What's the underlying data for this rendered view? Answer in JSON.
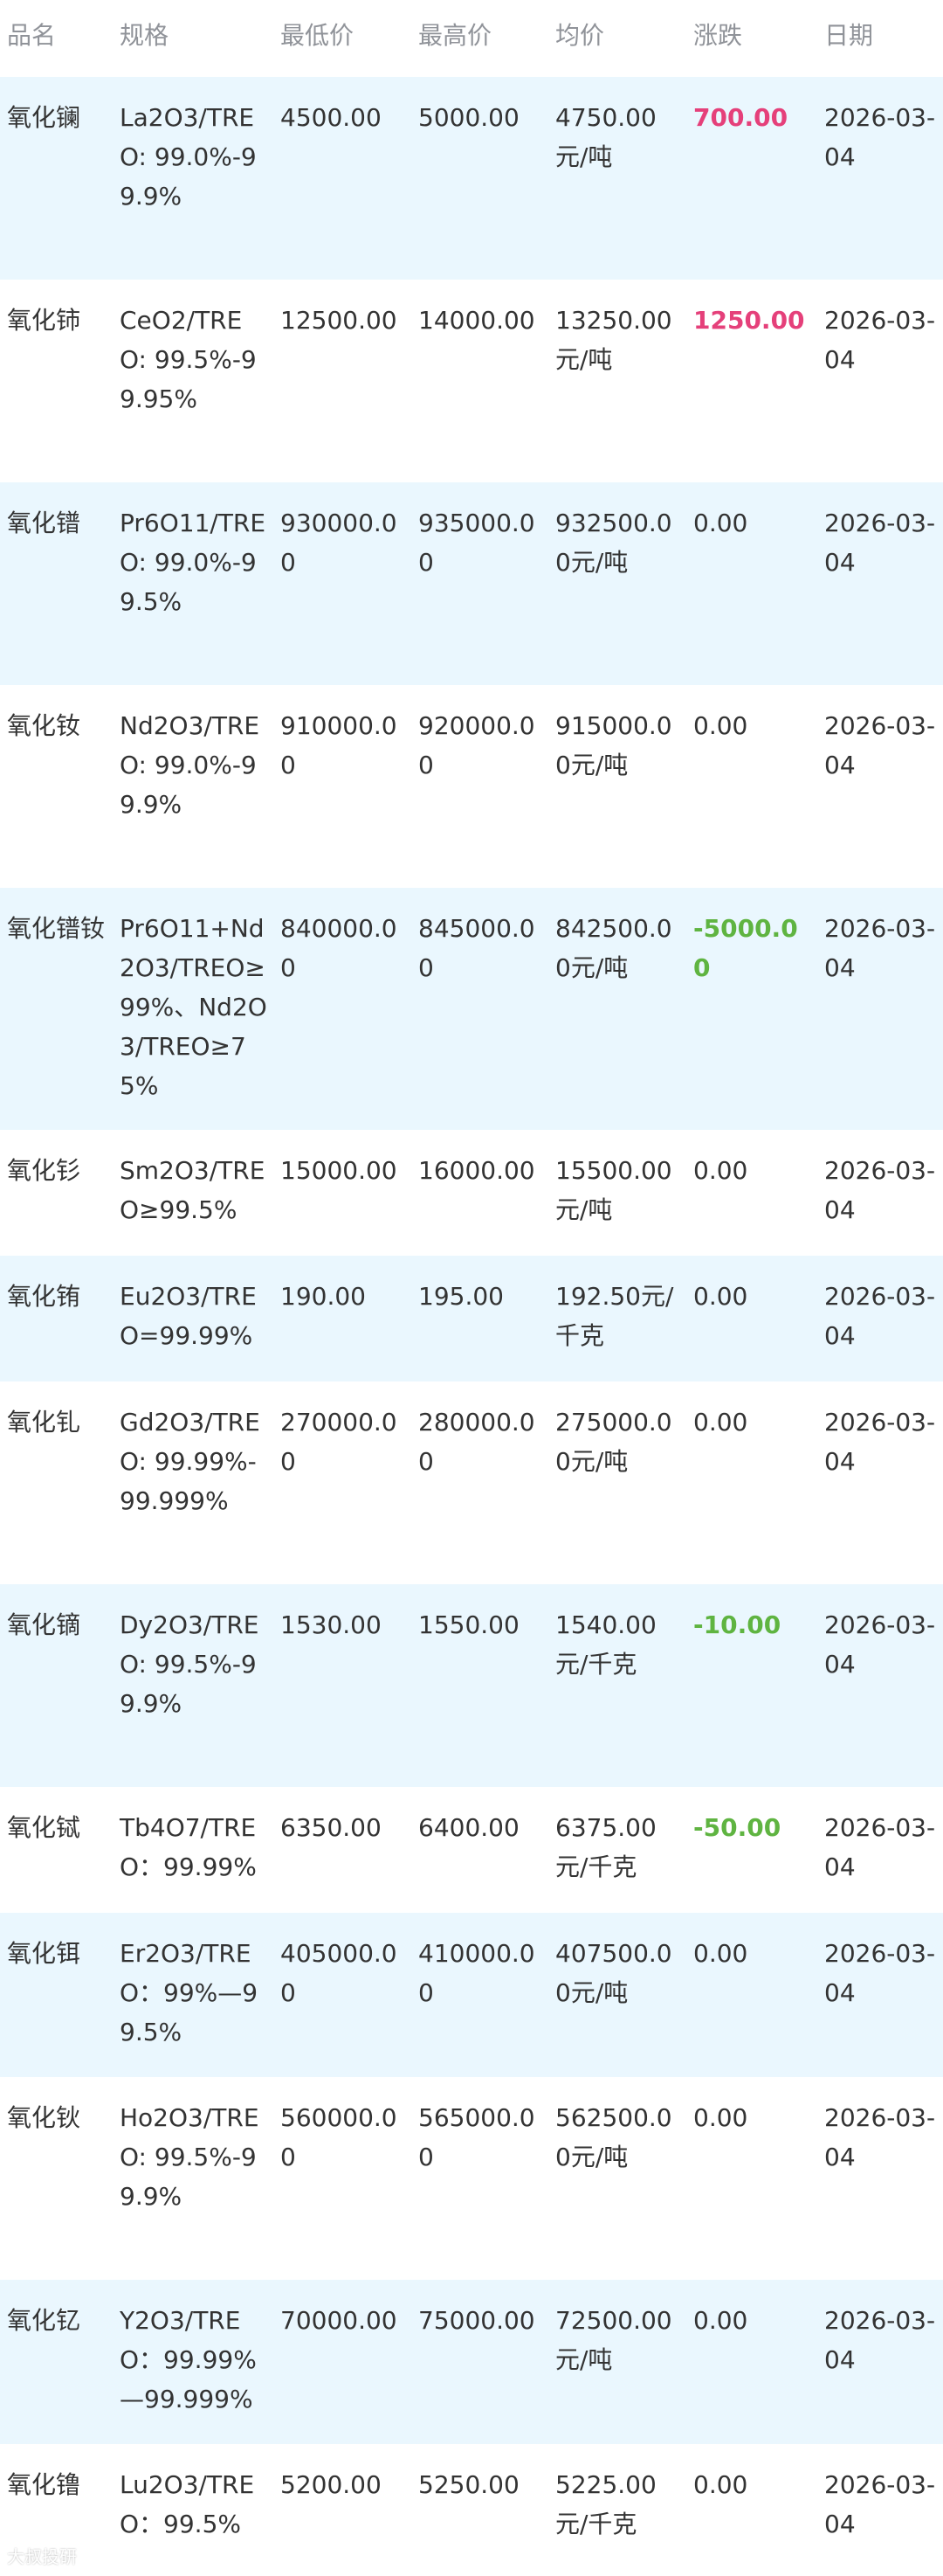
{
  "columns": {
    "name": "品名",
    "spec": "规格",
    "low": "最低价",
    "high": "最高价",
    "avg": "均价",
    "change": "涨跌",
    "date": "日期"
  },
  "colors": {
    "up": "#e5407a",
    "down": "#5fb441",
    "row_shade": "#eaf7fe",
    "header_text": "#909399"
  },
  "rows": [
    {
      "name": "氧化镧",
      "spec": "La2O3/TREO: 99.0%-99.9%",
      "low": "4500.00",
      "high": "5000.00",
      "avg": "4750.00元/吨",
      "change": "700.00",
      "trend": "up",
      "date": "2026-03-04"
    },
    {
      "name": "氧化铈",
      "spec": "CeO2/TREO: 99.5%-99.95%",
      "low": "12500.00",
      "high": "14000.00",
      "avg": "13250.00元/吨",
      "change": "1250.00",
      "trend": "up",
      "date": "2026-03-04"
    },
    {
      "name": "氧化镨",
      "spec": "Pr6O11/TREO: 99.0%-99.5%",
      "low": "930000.00",
      "high": "935000.00",
      "avg": "932500.00元/吨",
      "change": "0.00",
      "trend": "flat",
      "date": "2026-03-04"
    },
    {
      "name": "氧化钕",
      "spec": "Nd2O3/TREO: 99.0%-99.9%",
      "low": "910000.00",
      "high": "920000.00",
      "avg": "915000.00元/吨",
      "change": "0.00",
      "trend": "flat",
      "date": "2026-03-04"
    },
    {
      "name": "氧化镨钕",
      "spec": "Pr6O11+Nd2O3/TREO≥99%、Nd2O3/TREO≥75%",
      "low": "840000.00",
      "high": "845000.00",
      "avg": "842500.00元/吨",
      "change": "-5000.00",
      "trend": "down",
      "date": "2026-03-04"
    },
    {
      "name": "氧化钐",
      "spec": "Sm2O3/TREO≥99.5%",
      "low": "15000.00",
      "high": "16000.00",
      "avg": "15500.00元/吨",
      "change": "0.00",
      "trend": "flat",
      "date": "2026-03-04"
    },
    {
      "name": "氧化铕",
      "spec": "Eu2O3/TREO=99.99%",
      "low": "190.00",
      "high": "195.00",
      "avg": "192.50元/千克",
      "change": "0.00",
      "trend": "flat",
      "date": "2026-03-04"
    },
    {
      "name": "氧化钆",
      "spec": "Gd2O3/TREO: 99.99%-99.999%",
      "low": "270000.00",
      "high": "280000.00",
      "avg": "275000.00元/吨",
      "change": "0.00",
      "trend": "flat",
      "date": "2026-03-04"
    },
    {
      "name": "氧化镝",
      "spec": "Dy2O3/TREO: 99.5%-99.9%",
      "low": "1530.00",
      "high": "1550.00",
      "avg": "1540.00元/千克",
      "change": "-10.00",
      "trend": "down",
      "date": "2026-03-04"
    },
    {
      "name": "氧化铽",
      "spec": "Tb4O7/TREO：99.99%",
      "low": "6350.00",
      "high": "6400.00",
      "avg": "6375.00元/千克",
      "change": "-50.00",
      "trend": "down",
      "date": "2026-03-04"
    },
    {
      "name": "氧化铒",
      "spec": "Er2O3/TREO：99%—99.5%",
      "low": "405000.00",
      "high": "410000.00",
      "avg": "407500.00元/吨",
      "change": "0.00",
      "trend": "flat",
      "date": "2026-03-04"
    },
    {
      "name": "氧化钬",
      "spec": "Ho2O3/TREO: 99.5%-99.9%",
      "low": "560000.00",
      "high": "565000.00",
      "avg": "562500.00元/吨",
      "change": "0.00",
      "trend": "flat",
      "date": "2026-03-04"
    },
    {
      "name": "氧化钇",
      "spec": "Y2O3/TREO：99.99%—99.999%",
      "low": "70000.00",
      "high": "75000.00",
      "avg": "72500.00元/吨",
      "change": "0.00",
      "trend": "flat",
      "date": "2026-03-04"
    },
    {
      "name": "氧化镥",
      "spec": "Lu2O3/TREO：99.5%",
      "low": "5200.00",
      "high": "5250.00",
      "avg": "5225.00元/千克",
      "change": "0.00",
      "trend": "flat",
      "date": "2026-03-04"
    }
  ],
  "watermark": "大叔投研"
}
